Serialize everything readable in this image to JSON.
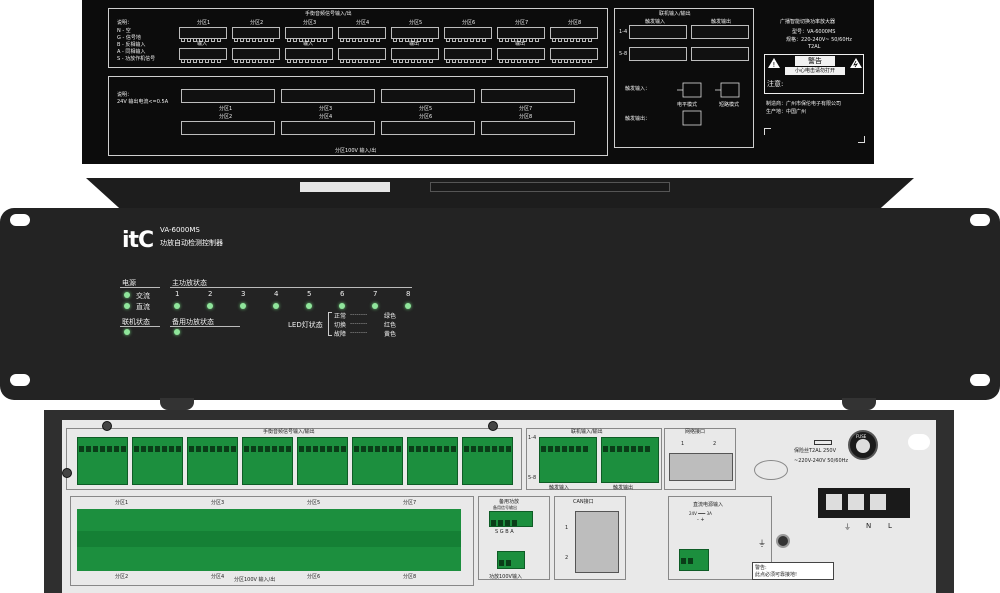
{
  "rear_label": {
    "section_fire_io": "手衡音频信号输入/出",
    "section_linkage_io": "联机输入/输出",
    "section_100v": "分区100V 输入/出",
    "legend_title": "说明：",
    "legend_lines": [
      "N - 空",
      "G - 信号地",
      "B - 反相输入",
      "A - 同相输入",
      "S - 功放作机信号"
    ],
    "power_note": "说明：\n24V 输出电流<=0.5A",
    "zone_tabs": [
      "分区1",
      "分区2",
      "分区3",
      "分区4",
      "分区5",
      "分区6",
      "分区7",
      "分区8"
    ],
    "io_labels": [
      "输入",
      "输出"
    ],
    "linkage_in": "触发输入",
    "linkage_out": "触发输出",
    "linkage_row_labels": [
      "1-4",
      "5-8"
    ],
    "linkage_in_label": "触发输入：",
    "linkage_out_label": "触发输出：",
    "mode_a": "电平模式",
    "mode_b": "短路模式",
    "product_name": "广播智能切换功率放大器",
    "model_line": "型号：VA-6000MS",
    "spec_line": "规格：220-240V~ 50/60Hz",
    "fuse_line": "T2AL",
    "warning_title": "警告",
    "warning_sub": "小心电击请勿打开",
    "caution_label": "注意:",
    "maker_line": "制造商：广州市保伦电子有限公司",
    "origin_line": "生产地：中国广州"
  },
  "front": {
    "brand": "itC",
    "model": "VA-6000MS",
    "subtitle": "功放自动检测控制器",
    "power_label": "电源",
    "ac_label": "交流",
    "dc_label": "直流",
    "main_amp_label": "主功放状态",
    "channel_numbers": [
      "1",
      "2",
      "3",
      "4",
      "5",
      "6",
      "7",
      "8"
    ],
    "link_label": "联机状态",
    "backup_label": "备用功放状态",
    "led_status_label": "LED灯状态",
    "status_rows": [
      {
        "state": "正常",
        "color": "绿色"
      },
      {
        "state": "切换",
        "color": "红色"
      },
      {
        "state": "故障",
        "color": "黄色"
      }
    ]
  },
  "rear": {
    "fire_io_title": "手衡音频信号输入/输出",
    "linkage_title": "联机输入/输出",
    "network_title": "网络接口",
    "network_ports": [
      "1",
      "2"
    ],
    "linkage_rows": [
      "1-4",
      "5-8"
    ],
    "linkage_in": "触发输入",
    "linkage_out": "触发输出",
    "zone_top": [
      "分区1",
      "分区2",
      "分区3",
      "分区4",
      "分区5",
      "分区6",
      "分区7",
      "分区8"
    ],
    "zone_100v_top": [
      "分区1",
      "分区3",
      "分区5",
      "分区7"
    ],
    "zone_100v_bottom": [
      "分区2",
      "分区4",
      "分区6",
      "分区8"
    ],
    "zone_100v_title": "分区100V 输入/出",
    "backup_title": "备用功放",
    "backup_signal": "备用信号输出",
    "backup_pins": "S G B A",
    "backup_100v": "功放100V输入",
    "can_title": "CAN接口",
    "can_ports": [
      "1",
      "2"
    ],
    "dc_title": "直流电源输入",
    "dc_spec": "24V ═══ 3A",
    "dc_pins": "-   +",
    "fuse_label": "保险丝T2AL 250V",
    "voltage_label": "~220V-240V 50/60Hz",
    "fuse_knob": "FUSE",
    "terminal_labels": [
      "⏚",
      "N",
      "L"
    ],
    "warning_title": "警告:",
    "warning_text": "此点必须可靠接地!"
  }
}
